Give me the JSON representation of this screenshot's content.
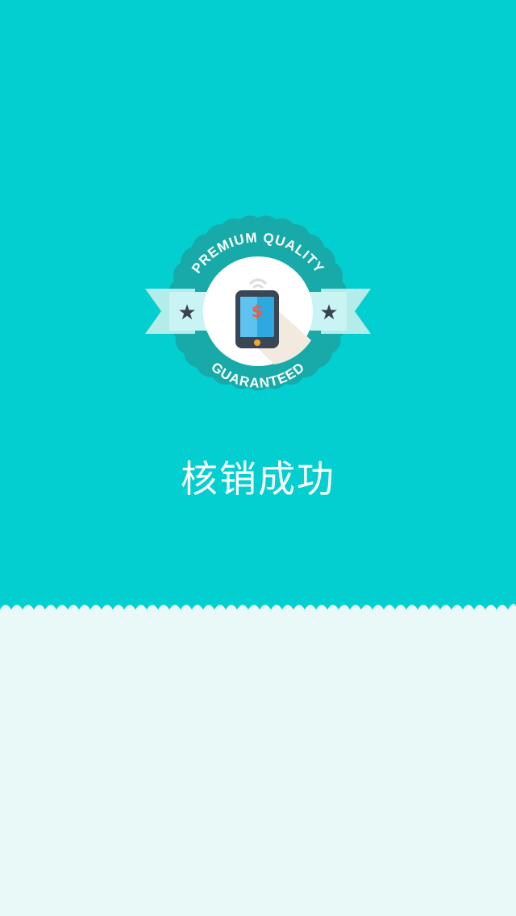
{
  "status": {
    "title": "核销成功"
  },
  "badge": {
    "top_text": "PREMIUM QUALITY",
    "bottom_text": "GUARANTEED",
    "currency_symbol": "$",
    "icon": "premium-quality-badge-icon"
  },
  "colors": {
    "background": "#03ced0",
    "badge_outer": "#17aaa8",
    "badge_inner_ring": "#1eb9b7",
    "ribbon": "#c9f4f3",
    "star": "#3a4250",
    "panel": "#e8f9f8"
  }
}
